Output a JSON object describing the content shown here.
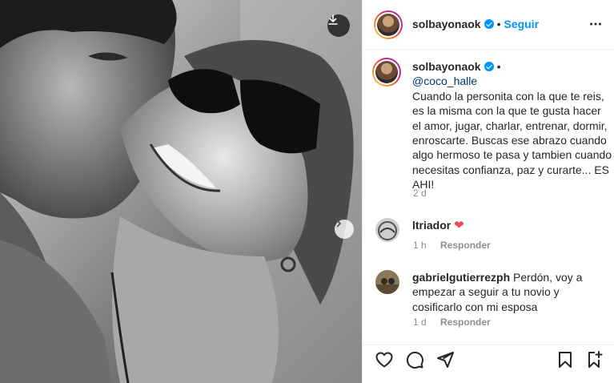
{
  "post": {
    "username": "solbayonaok",
    "follow_label": "Seguir",
    "header_separator": "•",
    "caption_separator": "•",
    "mention_prefix": "",
    "mention": "@coco_halle",
    "caption": "Cuando la personita con la que te reis, es la misma con la que te gusta hacer el amor, jugar, charlar, entrenar, dormir, enroscarte. Buscas ese abrazo cuando algo hermoso te pasa y tambien cuando necesitas confianza, paz y curarte... ES AHI!",
    "caption_time": "2 d"
  },
  "comments": [
    {
      "username": "ltriador",
      "text": "",
      "emoji": "❤",
      "time": "1 h",
      "reply_label": "Responder"
    },
    {
      "username": "gabrielgutierrezph",
      "text": "Perdón, voy a empezar a seguir a tu novio y cosificarlo con mi esposa",
      "time": "1 d",
      "reply_label": "Responder"
    }
  ],
  "icons": {
    "download": "download-icon",
    "next": "chevron-right-icon",
    "more": "more-options-icon",
    "like": "heart-icon",
    "comment": "comment-icon",
    "share": "paper-plane-icon",
    "save": "bookmark-icon",
    "save_more": "bookmark-plus-icon"
  },
  "colors": {
    "accent": "#0095f6",
    "heart": "#ed4956",
    "muted": "#8e8e8e"
  }
}
